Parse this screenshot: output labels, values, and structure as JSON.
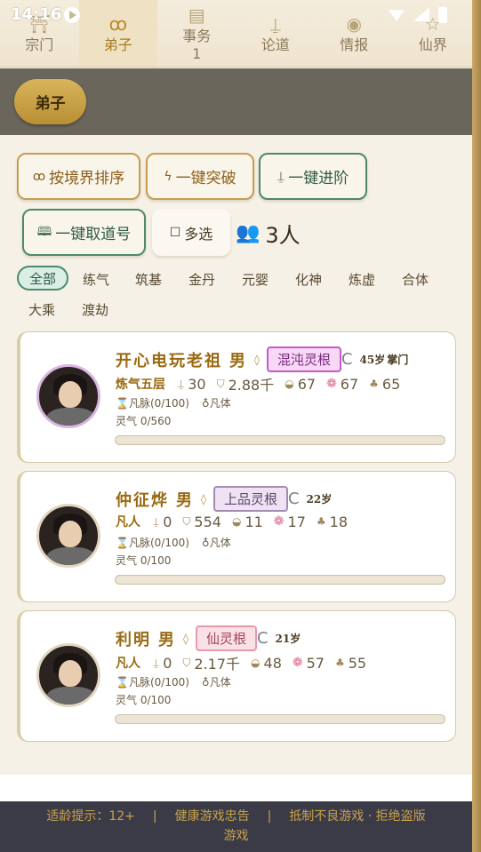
{
  "status": {
    "time": "14:16"
  },
  "nav": [
    {
      "label": "宗门",
      "icon": "sect-gate-icon",
      "active": false
    },
    {
      "label": "弟子",
      "icon": "disciples-icon",
      "active": true
    },
    {
      "label": "事务",
      "icon": "scroll-icon",
      "badge": "1",
      "active": false
    },
    {
      "label": "论道",
      "icon": "sword-icon",
      "active": false
    },
    {
      "label": "情报",
      "icon": "eye-icon",
      "active": false
    },
    {
      "label": "仙界",
      "icon": "star-icon",
      "active": false
    }
  ],
  "header": {
    "title": "弟子"
  },
  "actions": {
    "sort_by_realm": "按境界排序",
    "breakthrough_all": "一键突破",
    "advance_all": "一键进阶",
    "name_all": "一键取道号",
    "multi_select": "多选",
    "count": "3人"
  },
  "realms": [
    "全部",
    "练气",
    "筑基",
    "金丹",
    "元婴",
    "化神",
    "炼虚",
    "合体",
    "大乘",
    "渡劫"
  ],
  "active_realm": "全部",
  "disciples": [
    {
      "name": "开心电玩老祖",
      "gender": "男",
      "root": "混沌灵根",
      "age": "45岁",
      "sect_tag": "掌门",
      "realm": "炼气五层",
      "attack": "30",
      "defense": "2.88千",
      "speed": "67",
      "mind": "67",
      "luck": "65",
      "meridian": "凡脉(0/100)",
      "body": "凡体",
      "qi": "灵气 0/560",
      "qi_progress": 0
    },
    {
      "name": "仲征烨",
      "gender": "男",
      "root": "上品灵根",
      "age": "22岁",
      "sect_tag": "",
      "realm": "凡人",
      "attack": "0",
      "defense": "554",
      "speed": "11",
      "mind": "17",
      "luck": "18",
      "meridian": "凡脉(0/100)",
      "body": "凡体",
      "qi": "灵气 0/100",
      "qi_progress": 0
    },
    {
      "name": "利明",
      "gender": "男",
      "root": "仙灵根",
      "age": "21岁",
      "sect_tag": "",
      "realm": "凡人",
      "attack": "0",
      "defense": "2.17千",
      "speed": "48",
      "mind": "57",
      "luck": "55",
      "meridian": "凡脉(0/100)",
      "body": "凡体",
      "qi": "灵气 0/100",
      "qi_progress": 0
    }
  ],
  "footer": {
    "age_hint": "适龄提示：12+",
    "advice": "健康游戏忠告",
    "slogan_a": "抵制不良游戏 · 拒绝盗版",
    "slogan_b": "游戏"
  },
  "colors": {
    "accent_gold": "#b8892c",
    "header_band": "#6b665b",
    "footer_bg": "#3b3b48"
  }
}
